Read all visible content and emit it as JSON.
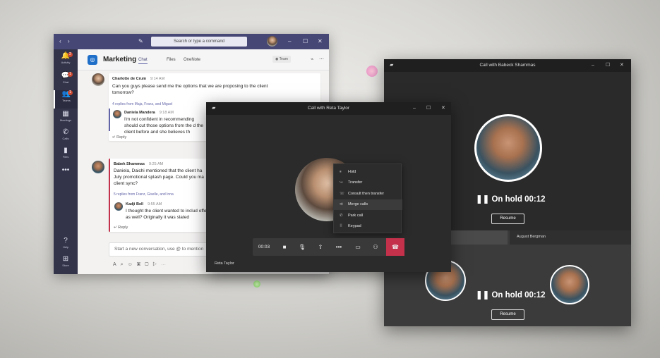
{
  "teams": {
    "search_placeholder": "Search or type a command",
    "rail": [
      {
        "icon": "🔔",
        "label": "Activity",
        "badge": "2"
      },
      {
        "icon": "💬",
        "label": "Chat",
        "badge": "1"
      },
      {
        "icon": "👥",
        "label": "Teams",
        "badge": "1"
      },
      {
        "icon": "▦",
        "label": "Meetings"
      },
      {
        "icon": "✆",
        "label": "Calls"
      },
      {
        "icon": "▮",
        "label": "Files"
      },
      {
        "icon": "•••",
        "label": ""
      }
    ],
    "rail_bottom": [
      {
        "icon": "?",
        "label": "Help"
      },
      {
        "icon": "⊞",
        "label": "Store"
      }
    ],
    "channel": {
      "title": "Marketing",
      "tabs": [
        "Chat",
        "Files",
        "OneNote"
      ],
      "team_label": "Team"
    },
    "posts": [
      {
        "author": "Charlotte de Crum",
        "time": "9:14 AM",
        "text": "Can you guys please send me the options that we are proposing to the client tomorrow?",
        "replies": "4 replies from Maja, Franz, and Miguel",
        "sub_author": "Daniela Mandera",
        "sub_time": "9:18 AM",
        "sub_text": "I'm not confident in recommending should cut those options from the d the client before and she believes th",
        "reply": "Reply"
      },
      {
        "author": "Babek Shammas",
        "time": "9:25 AM",
        "text": "Daniela, Daichi mentioned that the client ha July promotional splash page. Could you ma client sync?",
        "replies": "5 replies from Franz, Giselle, and Inna",
        "sub_author": "Kadji Bell",
        "sub_time": "9:55 AM",
        "sub_text": "I thought the client wanted to includ offer as well? Originally it was slated",
        "reply": "Reply"
      }
    ],
    "new_conversation": "Start a new conversation, use @ to mention"
  },
  "reta_call": {
    "title": "Call with Reta Taylor",
    "caller_name": "Reta Taylor",
    "timer": "00:03",
    "menu": [
      {
        "icon": "⏸",
        "label": "Hold"
      },
      {
        "icon": "↪",
        "label": "Transfer"
      },
      {
        "icon": "☏",
        "label": "Consult then transfer"
      },
      {
        "icon": "⇉",
        "label": "Merge calls"
      },
      {
        "icon": "✆",
        "label": "Park call"
      },
      {
        "icon": "⠿",
        "label": "Keypad"
      }
    ]
  },
  "babeck_call": {
    "title": "Call with Babeck Shammas",
    "hold_status": "On hold 00:12",
    "resume_label": "Resume",
    "second_participant": "August Bergman",
    "hold_status_2": "On hold 00:12",
    "resume_label_2": "Resume"
  },
  "colors": {
    "teams_purple": "#464775",
    "hangup_red": "#c4314b",
    "call_bg": "#2b2b2b"
  }
}
